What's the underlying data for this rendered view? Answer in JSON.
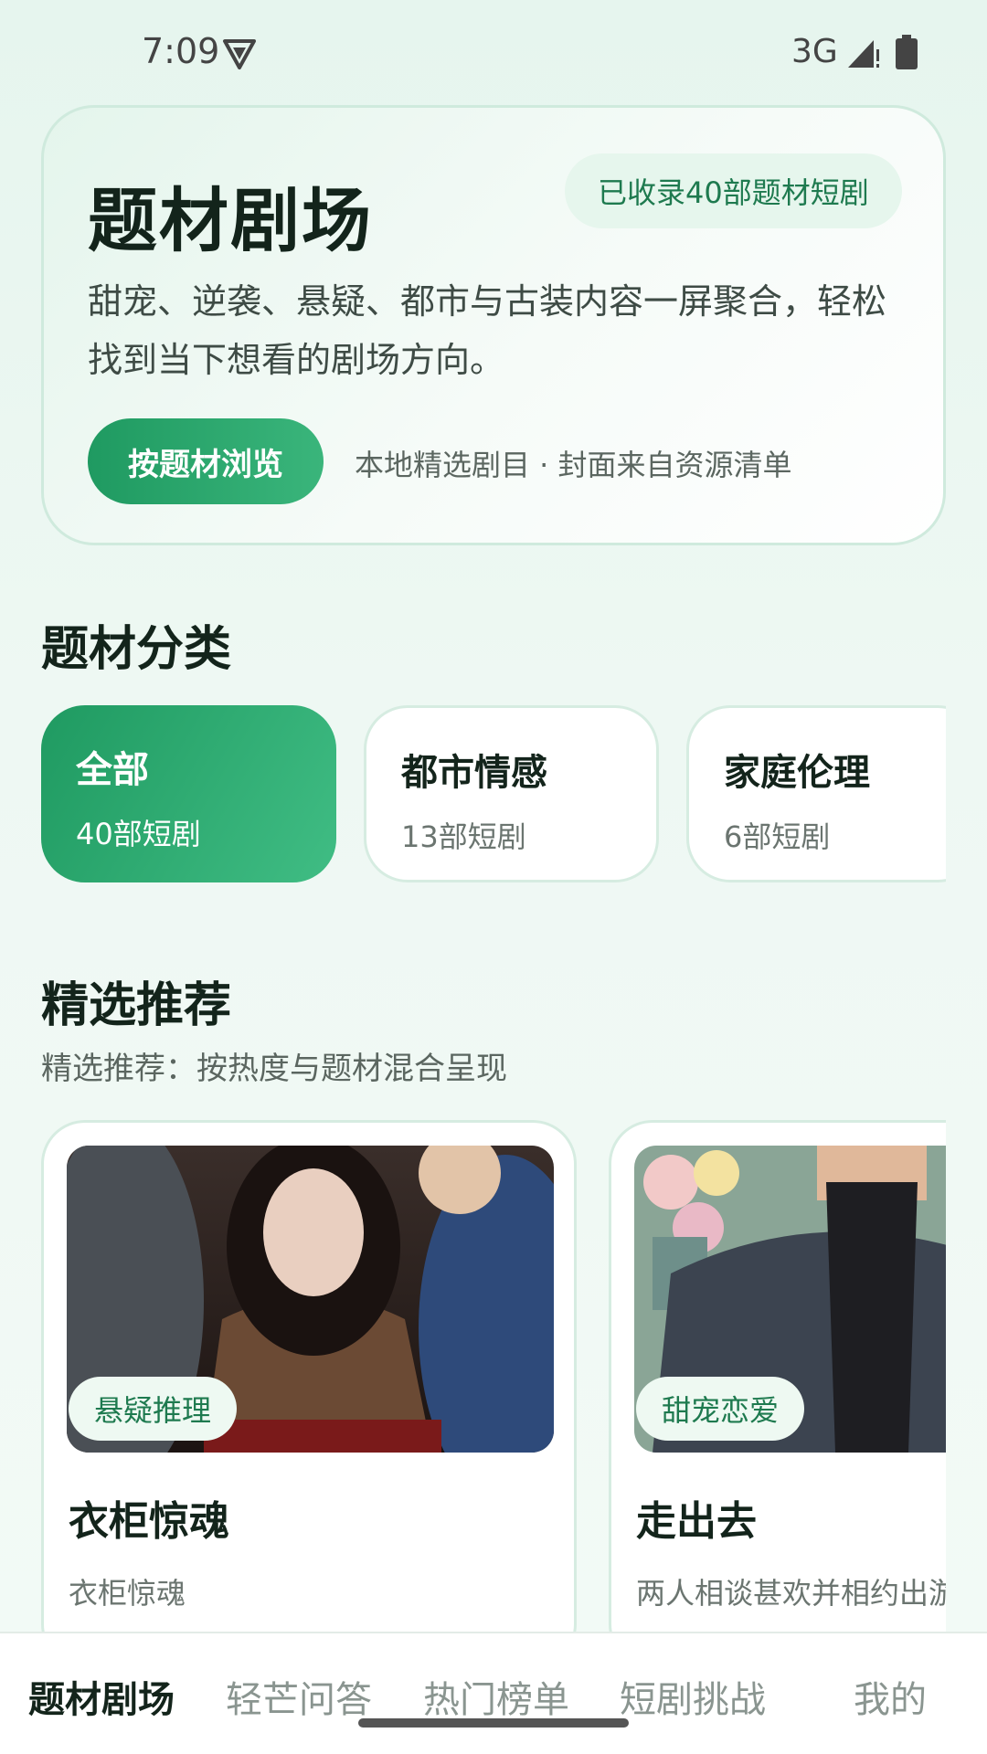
{
  "status_bar": {
    "time": "7:09",
    "network": "3G"
  },
  "hero": {
    "title": "题材剧场",
    "badge": "已收录40部题材短剧",
    "description": "甜宠、逆袭、悬疑、都市与古装内容一屏聚合，轻松找到当下想看的剧场方向。",
    "button_label": "按题材浏览",
    "note": "本地精选剧目 · 封面来自资源清单"
  },
  "categories": {
    "title": "题材分类",
    "items": [
      {
        "name": "全部",
        "count": "40部短剧",
        "active": true
      },
      {
        "name": "都市情感",
        "count": "13部短剧",
        "active": false
      },
      {
        "name": "家庭伦理",
        "count": "6部短剧",
        "active": false
      }
    ]
  },
  "recommend": {
    "title": "精选推荐",
    "subtitle": "精选推荐：按热度与题材混合呈现",
    "items": [
      {
        "tag": "悬疑推理",
        "name": "衣柜惊魂",
        "desc": "衣柜惊魂"
      },
      {
        "tag": "甜宠恋爱",
        "name": "走出去",
        "desc": "两人相谈甚欢并相约出游"
      }
    ]
  },
  "bottom_nav": {
    "items": [
      {
        "label": "题材剧场",
        "active": true
      },
      {
        "label": "轻芒问答",
        "active": false
      },
      {
        "label": "热门榜单",
        "active": false
      },
      {
        "label": "短剧挑战",
        "active": false
      },
      {
        "label": "我的",
        "active": false
      }
    ]
  },
  "colors": {
    "accent": "#1f9a61",
    "accent_light": "#40bd84",
    "background": "#e6f5ee"
  }
}
